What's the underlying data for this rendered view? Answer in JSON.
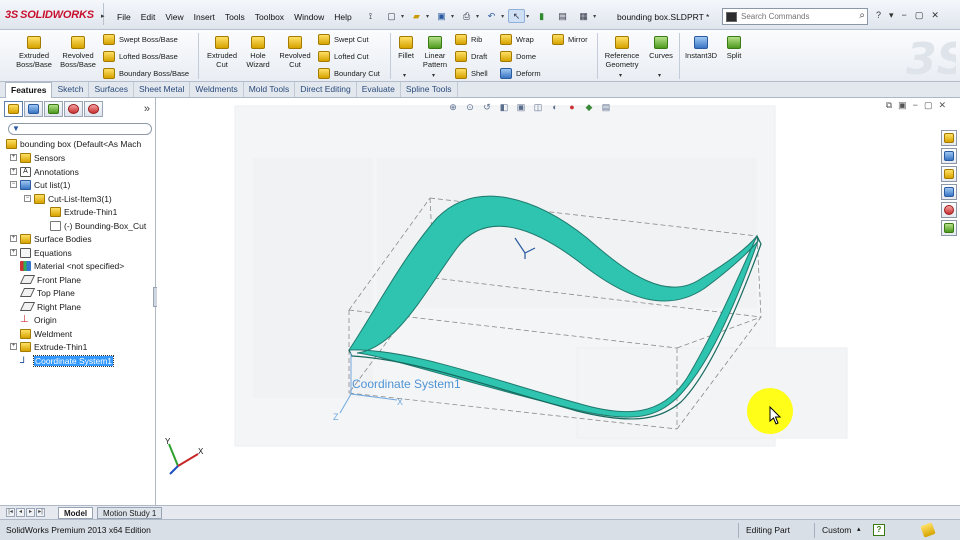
{
  "app": {
    "brand": "SOLIDWORKS",
    "brand_prefix": "3S",
    "document_title": "bounding box.SLDPRT *",
    "search_placeholder": "Search Commands"
  },
  "menu": [
    "File",
    "Edit",
    "View",
    "Insert",
    "Tools",
    "Toolbox",
    "Window",
    "Help"
  ],
  "commands": {
    "extruded_boss": "Extruded Boss/Base",
    "revolved_boss": "Revolved Boss/Base",
    "swept_boss": "Swept Boss/Base",
    "lofted_boss": "Lofted Boss/Base",
    "boundary_boss": "Boundary Boss/Base",
    "extruded_cut": "Extruded Cut",
    "hole_wizard": "Hole Wizard",
    "revolved_cut": "Revolved Cut",
    "swept_cut": "Swept Cut",
    "lofted_cut": "Lofted Cut",
    "boundary_cut": "Boundary Cut",
    "fillet": "Fillet",
    "linear_pattern": "Linear Pattern",
    "rib": "Rib",
    "draft": "Draft",
    "shell": "Shell",
    "wrap": "Wrap",
    "dome": "Dome",
    "deform": "Deform",
    "mirror": "Mirror",
    "reference_geometry": "Reference Geometry",
    "curves": "Curves",
    "instant3d": "Instant3D",
    "split": "Split"
  },
  "tabs": [
    "Features",
    "Sketch",
    "Surfaces",
    "Sheet Metal",
    "Weldments",
    "Mold Tools",
    "Direct Editing",
    "Evaluate",
    "Spline Tools"
  ],
  "active_tab": "Features",
  "tree": {
    "root": "bounding box  (Default<As Mach",
    "items": [
      "Sensors",
      "Annotations",
      "Cut list(1)",
      "Cut-List-Item3(1)",
      "Extrude-Thin1",
      "(-) Bounding-Box_Cut",
      "Surface Bodies",
      "Equations",
      "Material <not specified>",
      "Front Plane",
      "Top Plane",
      "Right Plane",
      "Origin",
      "Weldment",
      "Extrude-Thin1",
      "Coordinate System1"
    ],
    "selected": "Coordinate System1"
  },
  "viewport": {
    "coordinate_label": "Coordinate System1",
    "axis_x": "X",
    "axis_y": "Y",
    "axis_z": "Z",
    "part_color": "#2ec4b0"
  },
  "bottom_tabs": [
    "Model",
    "Motion Study 1"
  ],
  "status": {
    "edition": "SolidWorks Premium 2013 x64 Edition",
    "mode": "Editing Part",
    "units": "Custom"
  }
}
